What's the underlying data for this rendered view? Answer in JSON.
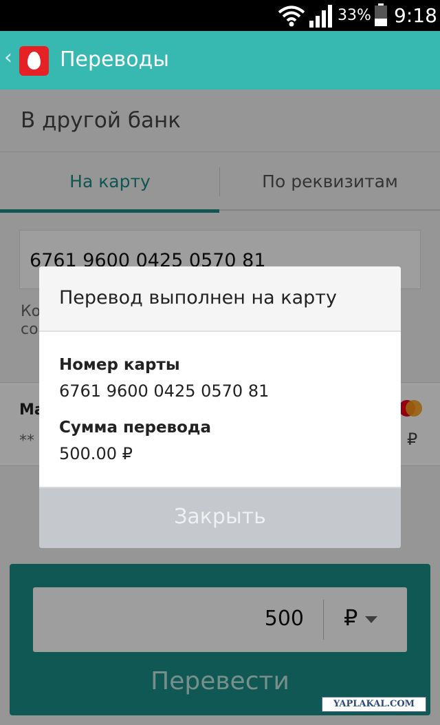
{
  "status_bar": {
    "battery_percent": "33%",
    "time": "9:18"
  },
  "app_bar": {
    "back_glyph": "‹",
    "title": "Переводы"
  },
  "page": {
    "section_title": "В другой банк",
    "tabs": [
      {
        "label": "На карту",
        "active": true
      },
      {
        "label": "По реквизитам",
        "active": false
      }
    ],
    "card_number_input": "6761 9600 0425 0570 81",
    "hint_text": "Ко со",
    "source_card": {
      "name": "Ма",
      "masked_number": "**",
      "currency_symbol": "₽"
    },
    "amount": "500",
    "currency": "₽",
    "submit_label": "Перевести"
  },
  "dialog": {
    "title": "Перевод выполнен на карту",
    "card_label": "Номер карты",
    "card_value": "6761 9600 0425 0570 81",
    "sum_label": "Сумма перевода",
    "sum_value": "500.00 ₽",
    "close_label": "Закрыть"
  },
  "watermark": "YAPLAKAL.COM",
  "colors": {
    "app_bar": "#37b8b0",
    "accent": "#1a8a82",
    "bottom_panel": "#1b8f88",
    "logo": "#e52126"
  }
}
